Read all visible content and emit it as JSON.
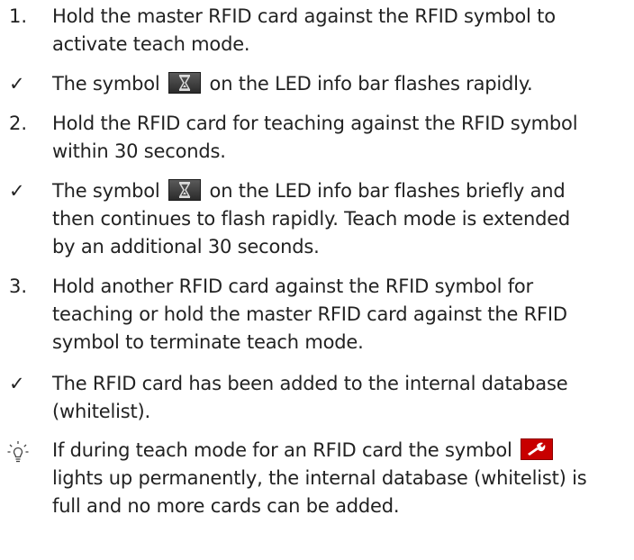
{
  "steps": [
    {
      "marker": "1.",
      "lines": [
        "Hold the master RFID card against the RFID symbol to",
        "activate teach mode."
      ]
    },
    {
      "marker": "✓",
      "pre": "The symbol",
      "icon": "hourglass-icon",
      "post": "on the LED info bar flashes rapidly."
    },
    {
      "marker": "2.",
      "lines": [
        "Hold the RFID card for teaching against the RFID symbol",
        "within 30 seconds."
      ]
    },
    {
      "marker": "✓",
      "pre": "The symbol",
      "icon": "hourglass-icon",
      "post": "on the LED info bar flashes briefly and",
      "lines": [
        "then continues to flash rapidly. Teach mode is extended",
        "by an additional 30 seconds."
      ]
    },
    {
      "marker": "3.",
      "lines": [
        "Hold another RFID card against the RFID symbol for",
        "teaching or hold the master RFID card against the RFID",
        "symbol to terminate teach mode."
      ]
    },
    {
      "marker": "✓",
      "lines": [
        "The RFID card has been added to the internal database",
        "(whitelist)."
      ]
    },
    {
      "marker": "bulb-icon",
      "pre": "If during teach mode for an RFID card the symbol",
      "icon": "wrench-icon",
      "lines": [
        "lights up permanently, the internal database (whitelist) is",
        "full and no more cards can be added."
      ]
    }
  ],
  "colors": {
    "wrench_bg": "#c80000",
    "hourglass_bg": "#3a3a3a",
    "text": "#222222"
  }
}
